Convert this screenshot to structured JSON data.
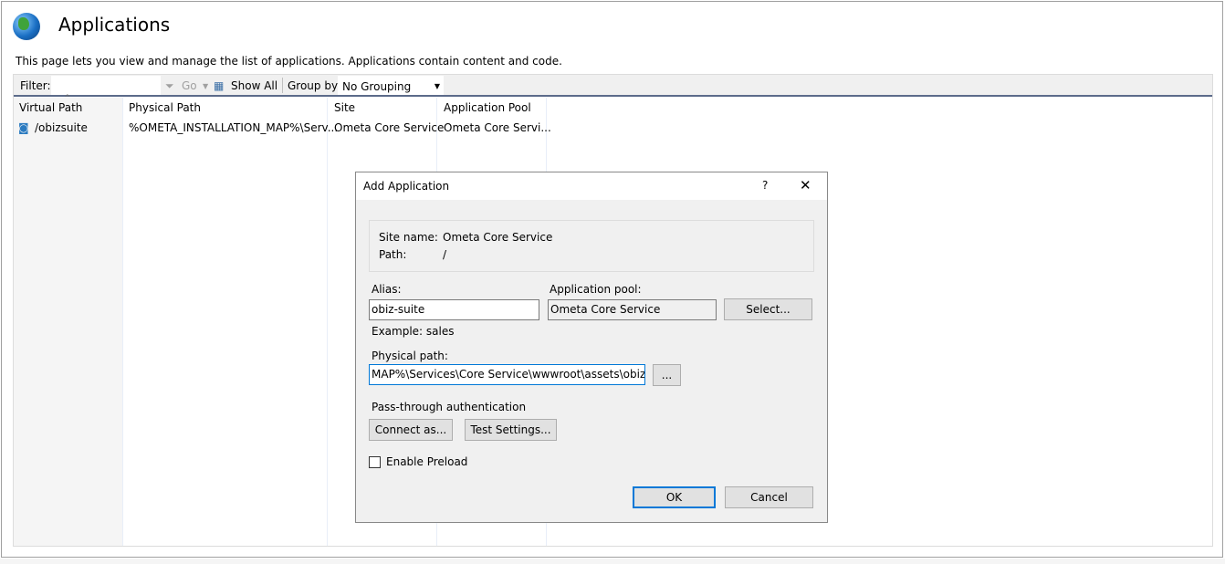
{
  "page": {
    "title": "Applications",
    "description": "This page lets you view and manage the list of applications. Applications contain content and code.",
    "icon": "globe-icon"
  },
  "toolbar": {
    "filter_label": "Filter:",
    "filter_value": "",
    "go_label": "Go",
    "show_all_label": "Show All",
    "group_by_label": "Group by:",
    "group_by_value": "No Grouping"
  },
  "table": {
    "columns": [
      "Virtual Path",
      "Physical Path",
      "Site",
      "Application Pool"
    ],
    "sorted_column": "Virtual Path",
    "rows": [
      {
        "virtual_path": "/obizsuite",
        "physical_path": "%OMETA_INSTALLATION_MAP%\\Serv...",
        "site": "Ometa Core Service",
        "app_pool": "Ometa Core Servi..."
      }
    ]
  },
  "dialog": {
    "title": "Add Application",
    "help": "?",
    "close": "✕",
    "site_name_label": "Site name:",
    "site_name": "Ometa Core Service",
    "path_label": "Path:",
    "path": "/",
    "alias_label": "Alias:",
    "alias_value": "obiz-suite",
    "example": "Example: sales",
    "app_pool_label": "Application pool:",
    "app_pool_value": "Ometa Core Service",
    "select_label": "Select...",
    "physical_path_label": "Physical path:",
    "physical_path_value": "MAP%\\Services\\Core Service\\wwwroot\\assets\\obiz-suite",
    "browse_label": "...",
    "passthrough_label": "Pass-through authentication",
    "connect_as_label": "Connect as...",
    "test_settings_label": "Test Settings...",
    "enable_preload_label": "Enable Preload",
    "enable_preload_checked": false,
    "ok_label": "OK",
    "cancel_label": "Cancel"
  }
}
